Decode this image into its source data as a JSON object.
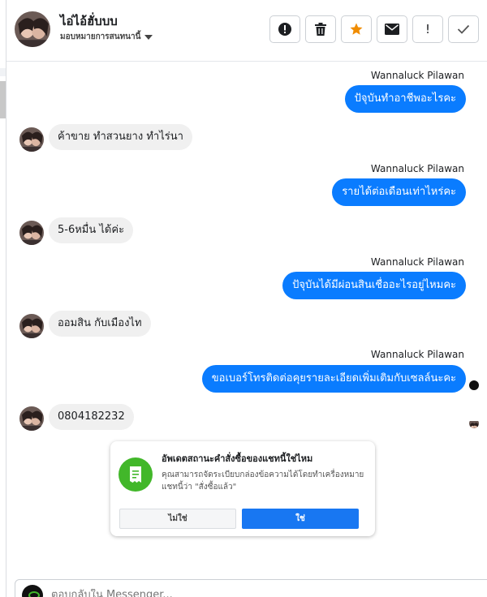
{
  "header": {
    "name": "ไอ่ไอ้ฮั่บบบ",
    "subtitle": "มอบหมายการสนทนานี้"
  },
  "toolbar": {
    "buttons": [
      {
        "icon": "alert-circle-icon"
      },
      {
        "icon": "trash-icon"
      },
      {
        "icon": "star-icon",
        "color": "#f08c00"
      },
      {
        "icon": "envelope-icon"
      },
      {
        "label": "!"
      },
      {
        "icon": "check-icon"
      }
    ]
  },
  "thread": {
    "messages": [
      {
        "direction": "out",
        "sender": "Wannaluck Pilawan",
        "text": "ปัจุบันทำอาชีพอะไรคะ"
      },
      {
        "direction": "in",
        "text": "ค้าขาย  ทำสวนยาง ทำไร่นา"
      },
      {
        "direction": "out",
        "sender": "Wannaluck Pilawan",
        "text": "รายได้ต่อเดือนเท่าไหร่คะ"
      },
      {
        "direction": "in",
        "text": "5-6หมื่น  ได้ค่ะ"
      },
      {
        "direction": "out",
        "sender": "Wannaluck Pilawan",
        "text": "ปัจุบันได้มีผ่อนสินเชื่ออะไรอยู่ไหมคะ"
      },
      {
        "direction": "in",
        "text": "ออมสิน  กับเมืองไท"
      },
      {
        "direction": "out",
        "sender": "Wannaluck Pilawan",
        "text": "ขอเบอร์โทรติดต่อคุยรายละเอียดเพิ่มเติมกับเซลล์นะคะ"
      },
      {
        "direction": "in",
        "text": "0804182232"
      }
    ]
  },
  "prompt_card": {
    "title": "อัพเดตสถานะคำสั่งซื้อของแชทนี้ใช่ไหม",
    "body": "คุณสามารถจัดระเบียบกล่องข้อความได้โดยทำเครื่องหมายแชทนี้ว่า \"สั่งซื้อแล้ว\"",
    "no_label": "ไม่ใช่",
    "yes_label": "ใช่",
    "icon": "order-receipt-icon",
    "accent": "#42b72a"
  },
  "composer": {
    "placeholder": "ตอบกลับใน Messenger..."
  },
  "colors": {
    "outgoing_bubble": "#0a7cff",
    "incoming_bubble": "#f0f0f0",
    "primary_button": "#1877f2"
  }
}
